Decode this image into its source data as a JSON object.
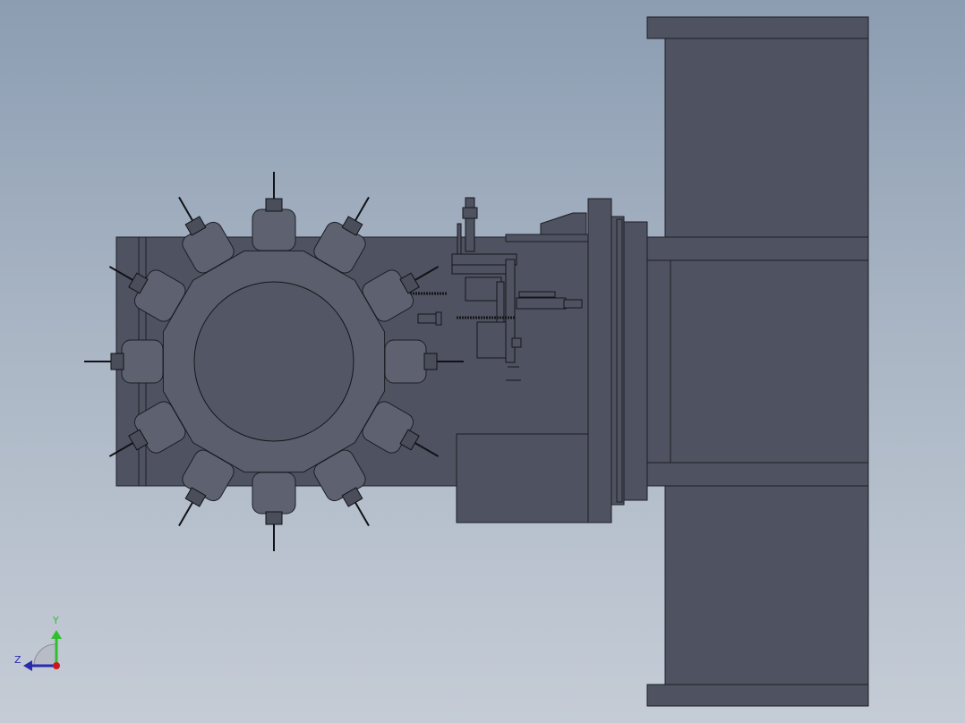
{
  "viewport": {
    "colors": {
      "body_fill": "#4f5361",
      "body_stroke": "#1c1e24",
      "hub_fill": "#5b5f6d",
      "detail_stroke": "#15161a",
      "axis_y": "#2fbf2f",
      "axis_z": "#2a2ab0",
      "axis_x": "#d01818"
    }
  },
  "triad": {
    "y_label": "Y",
    "z_label": "Z"
  },
  "model": {
    "spoke_count": 12
  }
}
